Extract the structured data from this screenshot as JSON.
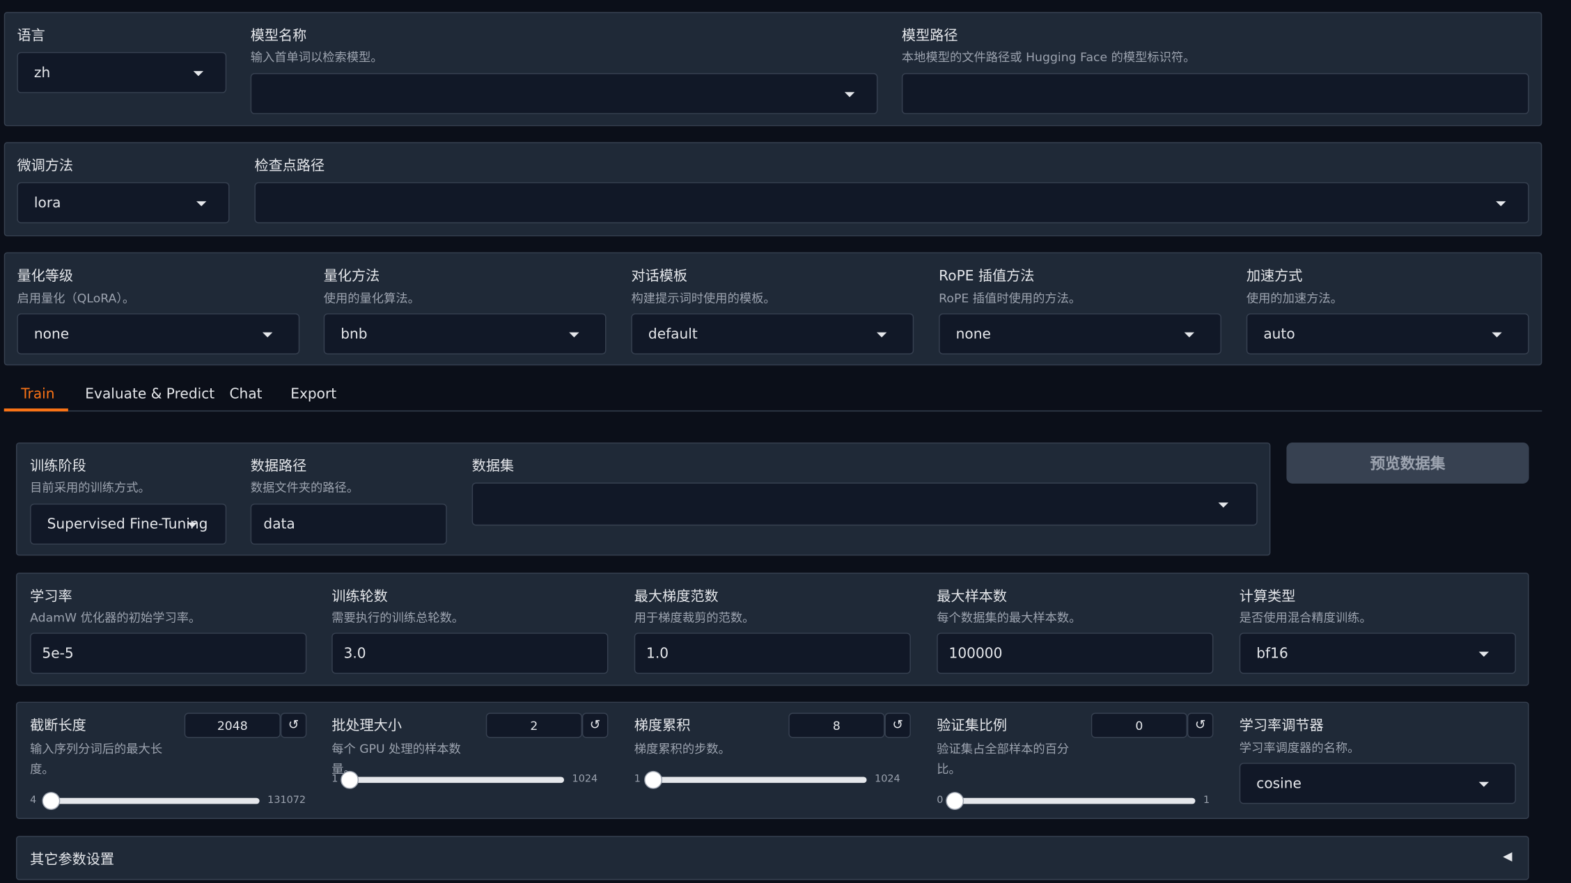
{
  "top": {
    "lang": {
      "label": "语言",
      "value": "zh"
    },
    "model_name": {
      "label": "模型名称",
      "info": "输入首单词以检索模型。",
      "value": ""
    },
    "model_path": {
      "label": "模型路径",
      "info": "本地模型的文件路径或 Hugging Face 的模型标识符。",
      "value": ""
    }
  },
  "finetune": {
    "method": {
      "label": "微调方法",
      "value": "lora"
    },
    "checkpoint": {
      "label": "检查点路径",
      "value": ""
    }
  },
  "advanced": [
    {
      "label": "量化等级",
      "info": "启用量化（QLoRA）。",
      "value": "none"
    },
    {
      "label": "量化方法",
      "info": "使用的量化算法。",
      "value": "bnb"
    },
    {
      "label": "对话模板",
      "info": "构建提示词时使用的模板。",
      "value": "default"
    },
    {
      "label": "RoPE 插值方法",
      "info": "RoPE 插值时使用的方法。",
      "value": "none"
    },
    {
      "label": "加速方式",
      "info": "使用的加速方法。",
      "value": "auto"
    }
  ],
  "tabs": [
    {
      "label": "Train",
      "active": true
    },
    {
      "label": "Evaluate & Predict"
    },
    {
      "label": "Chat"
    },
    {
      "label": "Export"
    }
  ],
  "train": {
    "stage": {
      "label": "训练阶段",
      "info": "目前采用的训练方式。",
      "value": "Supervised Fine-Tuning"
    },
    "dataset_dir": {
      "label": "数据路径",
      "info": "数据文件夹的路径。",
      "value": "data"
    },
    "dataset": {
      "label": "数据集",
      "value": ""
    },
    "preview_button": "预览数据集",
    "row2": [
      {
        "label": "学习率",
        "info": "AdamW 优化器的初始学习率。",
        "value": "5e-5"
      },
      {
        "label": "训练轮数",
        "info": "需要执行的训练总轮数。",
        "value": "3.0"
      },
      {
        "label": "最大梯度范数",
        "info": "用于梯度裁剪的范数。",
        "value": "1.0"
      },
      {
        "label": "最大样本数",
        "info": "每个数据集的最大样本数。",
        "value": "100000"
      },
      {
        "label": "计算类型",
        "info": "是否使用混合精度训练。",
        "value": "bf16"
      }
    ],
    "sliders": [
      {
        "label": "截断长度",
        "info": "输入序列分词后的最大长度。",
        "value": "2048",
        "min": "4",
        "max": "131072",
        "fraction": 0.0156
      },
      {
        "label": "批处理大小",
        "info": "每个 GPU 处理的样本数量。",
        "value": "2",
        "min": "1",
        "max": "1024",
        "fraction": 0.001
      },
      {
        "label": "梯度累积",
        "info": "梯度累积的步数。",
        "value": "8",
        "min": "1",
        "max": "1024",
        "fraction": 0.007
      },
      {
        "label": "验证集比例",
        "info": "验证集占全部样本的百分比。",
        "value": "0",
        "min": "0",
        "max": "1",
        "fraction": 0.0
      }
    ],
    "reset_icon": "↺",
    "lr_scheduler": {
      "label": "学习率调节器",
      "info": "学习率调度器的名称。",
      "value": "cosine"
    },
    "other_settings": {
      "label": "其它参数设置",
      "icon": "◀"
    }
  },
  "colors": {
    "accent": "#f97316",
    "panel": "#1f2937",
    "input": "#111827",
    "background": "#0b0f19"
  }
}
